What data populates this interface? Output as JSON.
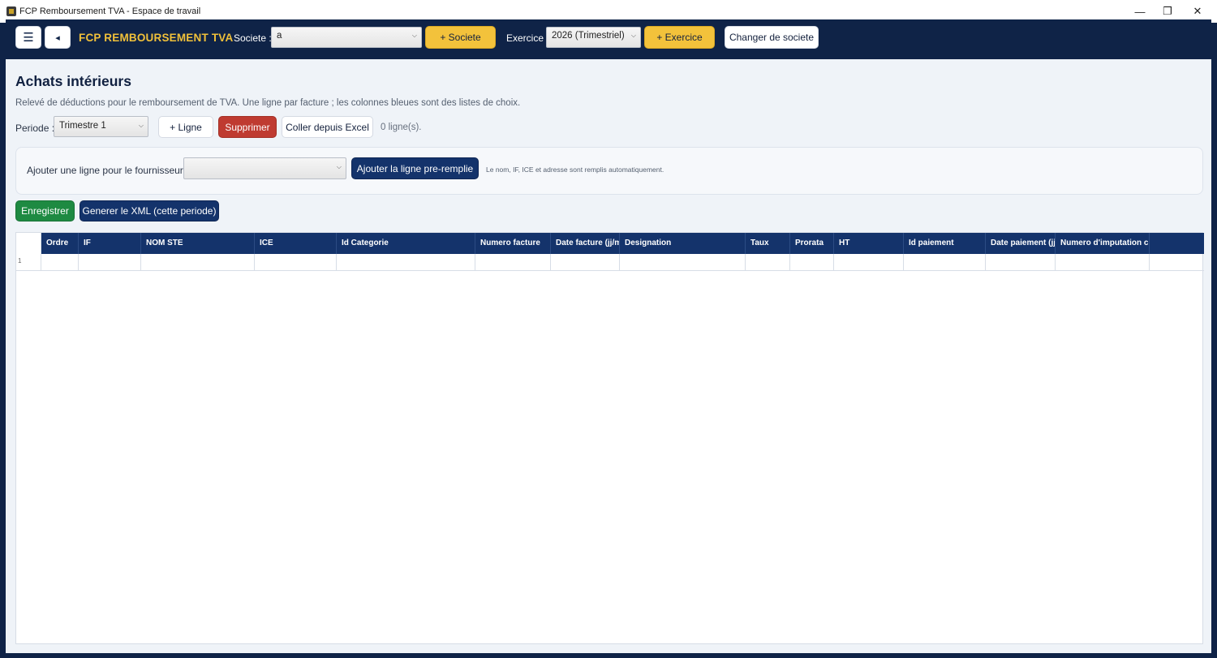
{
  "window": {
    "title": "FCP Remboursement TVA - Espace de travail",
    "controls": {
      "minimize": "—",
      "restore": "❐",
      "close": "✕"
    }
  },
  "nav": {
    "menu_icon": "☰",
    "back_icon": "◂",
    "brand": "FCP REMBOURSEMENT TVA",
    "societe_label": "Societe :",
    "societe_value": "a",
    "add_societe": "+ Societe",
    "exercice_label": "Exercice :",
    "exercice_value": "2026 (Trimestriel)",
    "add_exercice": "+ Exercice",
    "change_societe": "Changer de societe"
  },
  "page": {
    "title": "Achats intérieurs",
    "subtitle": "Relevé de déductions pour le remboursement de TVA. Une ligne par facture ; les colonnes bleues sont des listes de choix.",
    "periode_label": "Periode :",
    "periode_value": "Trimestre 1",
    "add_line": "+ Ligne",
    "delete": "Supprimer",
    "paste_excel": "Coller depuis Excel",
    "row_count": "0 ligne(s)."
  },
  "supplier": {
    "label": "Ajouter une ligne pour le fournisseur :",
    "value": "",
    "add_prefilled": "Ajouter la ligne pre-remplie",
    "hint": "Le nom, IF, ICE et adresse sont remplis automatiquement."
  },
  "actions": {
    "save": "Enregistrer",
    "generate_xml": "Generer le XML (cette periode)"
  },
  "grid": {
    "columns": [
      "Ordre",
      "IF",
      "NOM STE",
      "ICE",
      "Id Categorie",
      "Numero facture",
      "Date facture (jj/mm/aaaa)",
      "Designation",
      "Taux",
      "Prorata",
      "HT",
      "Id paiement",
      "Date paiement (jj/mm/aaaa)",
      "Numero d'imputation c",
      ""
    ],
    "rows": [
      {
        "num": "1",
        "cells": [
          "",
          "",
          "",
          "",
          "",
          "",
          "",
          "",
          "",
          "",
          "",
          "",
          "",
          "",
          ""
        ]
      }
    ]
  },
  "colors": {
    "navy": "#0f2347",
    "header_blue": "#14336b",
    "brand_yellow": "#f0c03a",
    "button_yellow": "#f3c23b",
    "danger_red": "#bf3b31",
    "success_green": "#1e8a42",
    "content_bg": "#eff3f8"
  }
}
